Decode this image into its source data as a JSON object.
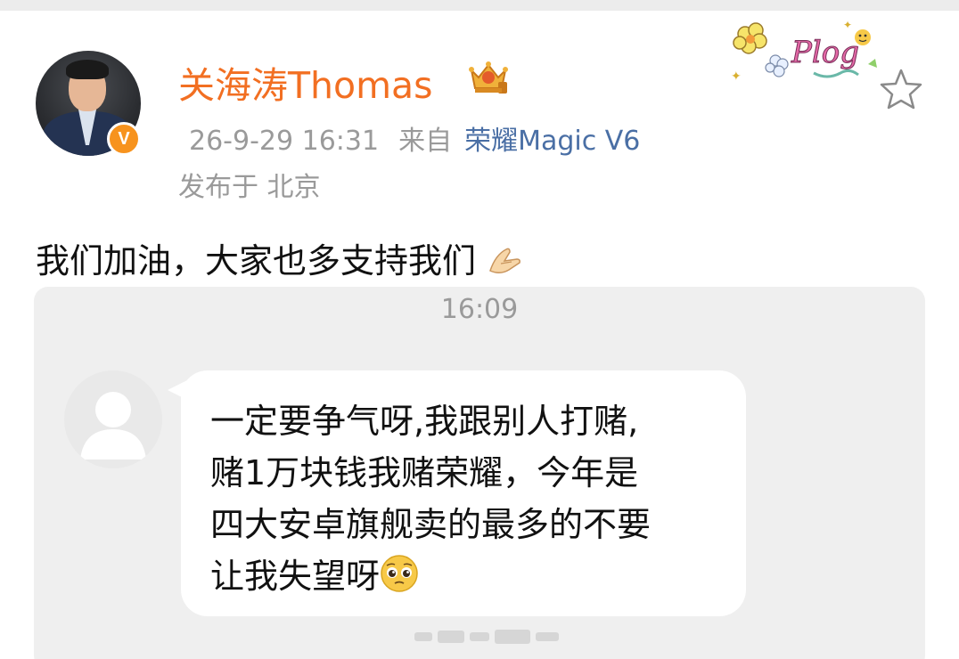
{
  "post": {
    "author": "关海涛Thomas",
    "verified_badge": "V",
    "timestamp": "26-9-29 16:31",
    "source_prefix": "来自",
    "device": "荣耀Magic V6",
    "location": "发布于 北京",
    "text": "我们加油，大家也多支持我们",
    "icons": [
      "crown-vip-icon",
      "plog-sticker",
      "star-icon",
      "pressed-hands-emoji"
    ]
  },
  "screenshot": {
    "chat_time": "16:09",
    "message_lines": [
      "一定要争气呀,我跟别人打赌,",
      "赌1万块钱我赌荣耀，今年是",
      "四大安卓旗舰卖的最多的不要",
      "让我失望呀"
    ],
    "icons": [
      "default-avatar-icon",
      "pleading-face-emoji"
    ]
  },
  "colors": {
    "author_orange": "#f26f22",
    "device_link_blue": "#4a6fa5",
    "meta_gray": "#9a9a9a",
    "chat_background": "#efefef"
  }
}
